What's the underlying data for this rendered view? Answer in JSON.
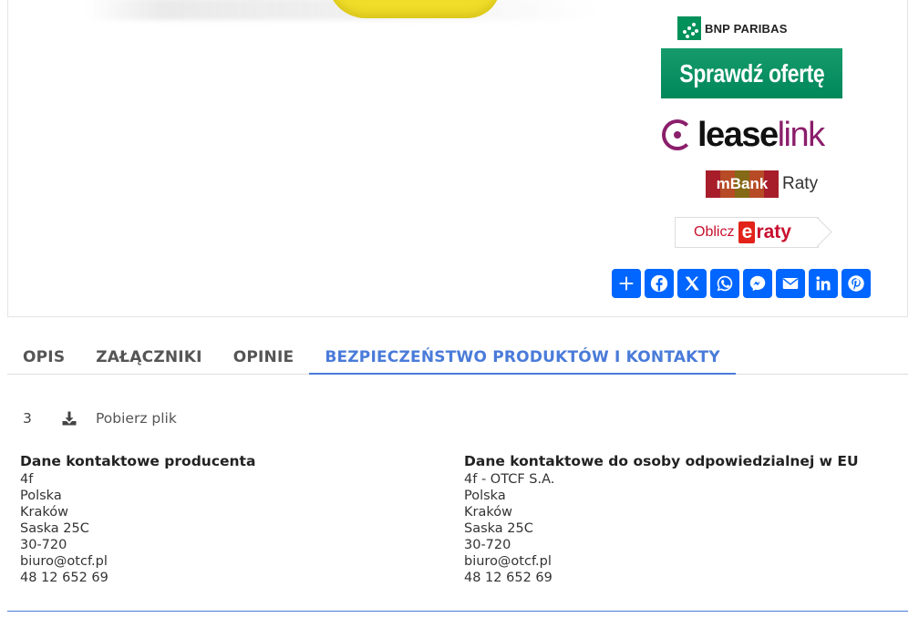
{
  "financing": {
    "bnp_name": "BNP PARIBAS",
    "sprawdz_label": "Sprawdź ofertę",
    "leaselink_bold": "lease",
    "leaselink_light": "link",
    "mbank_name": "mBank",
    "mbank_raty": "Raty",
    "eraty_oblicz": "Oblicz",
    "eraty_e": "e",
    "eraty_rest": "raty"
  },
  "share": {
    "buttons": [
      "share-icon",
      "facebook-icon",
      "x-icon",
      "whatsapp-icon",
      "messenger-icon",
      "email-icon",
      "linkedin-icon",
      "pinterest-icon"
    ],
    "color": "#0166ff"
  },
  "tabs": [
    {
      "label": "OPIS"
    },
    {
      "label": "ZAŁĄCZNIKI"
    },
    {
      "label": "OPINIE"
    },
    {
      "label": "BEZPIECZEŃSTWO PRODUKTÓW I KONTAKTY"
    }
  ],
  "active_tab_color": "#4a7bd9",
  "attachment": {
    "number": "3",
    "link": "Pobierz plik"
  },
  "producer": {
    "heading": "Dane kontaktowe producenta",
    "lines": [
      "4f",
      "Polska",
      "Kraków",
      "Saska 25C",
      "30-720",
      "biuro@otcf.pl",
      "48 12 652 69"
    ]
  },
  "eu_contact": {
    "heading": "Dane kontaktowe do osoby odpowiedzialnej w EU",
    "lines": [
      "4f - OTCF S.A.",
      "Polska",
      "Kraków",
      "Saska 25C",
      "30-720",
      "biuro@otcf.pl",
      "48 12 652 69"
    ]
  }
}
